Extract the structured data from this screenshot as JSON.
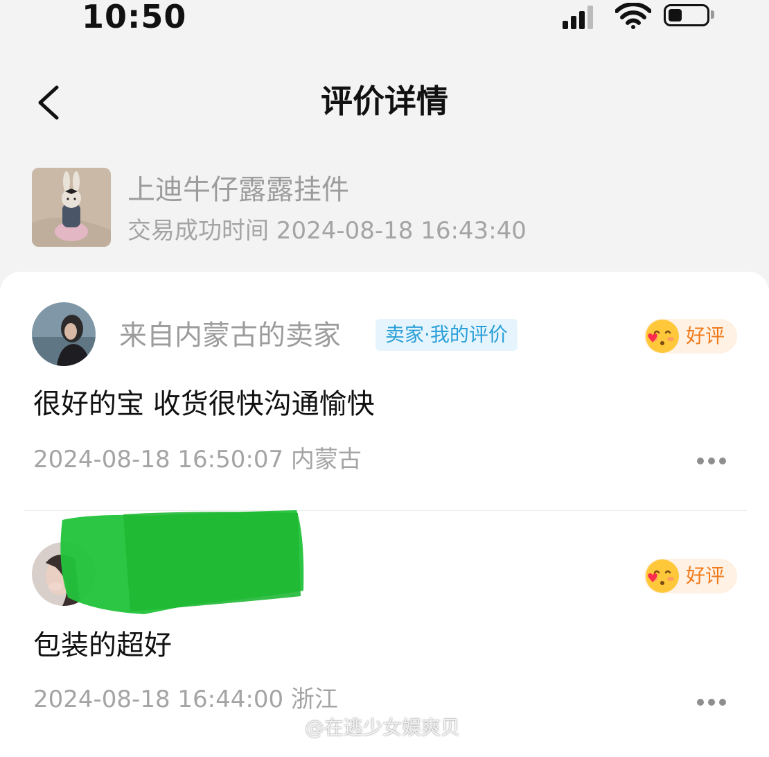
{
  "status_bar": {
    "time": "10:50",
    "signal_icon": "cellular-signal-icon",
    "wifi_icon": "wifi-icon",
    "battery_icon": "battery-icon",
    "battery_level": 0.3
  },
  "header": {
    "title": "评价详情",
    "back_icon": "chevron-left-icon"
  },
  "product": {
    "name": "上迪牛仔露露挂件",
    "trade_time": "交易成功时间 2024-08-18 16:43:40"
  },
  "reviews": [
    {
      "reviewer": "来自内蒙古的卖家",
      "tag": "卖家·我的评价",
      "rating": "好评",
      "text": "很好的宝 收货很快沟通愉快",
      "meta": "2024-08-18 16:50:07  内蒙古"
    },
    {
      "reviewer": "",
      "rating": "好评",
      "text": "包装的超好",
      "meta": "2024-08-18 16:44:00  浙江"
    }
  ],
  "watermark": "@在逃少女娱爽贝",
  "colors": {
    "tag_blue": "#2a9fd8",
    "rating_orange": "#f07a1a",
    "redaction_green": "#22c33a"
  }
}
